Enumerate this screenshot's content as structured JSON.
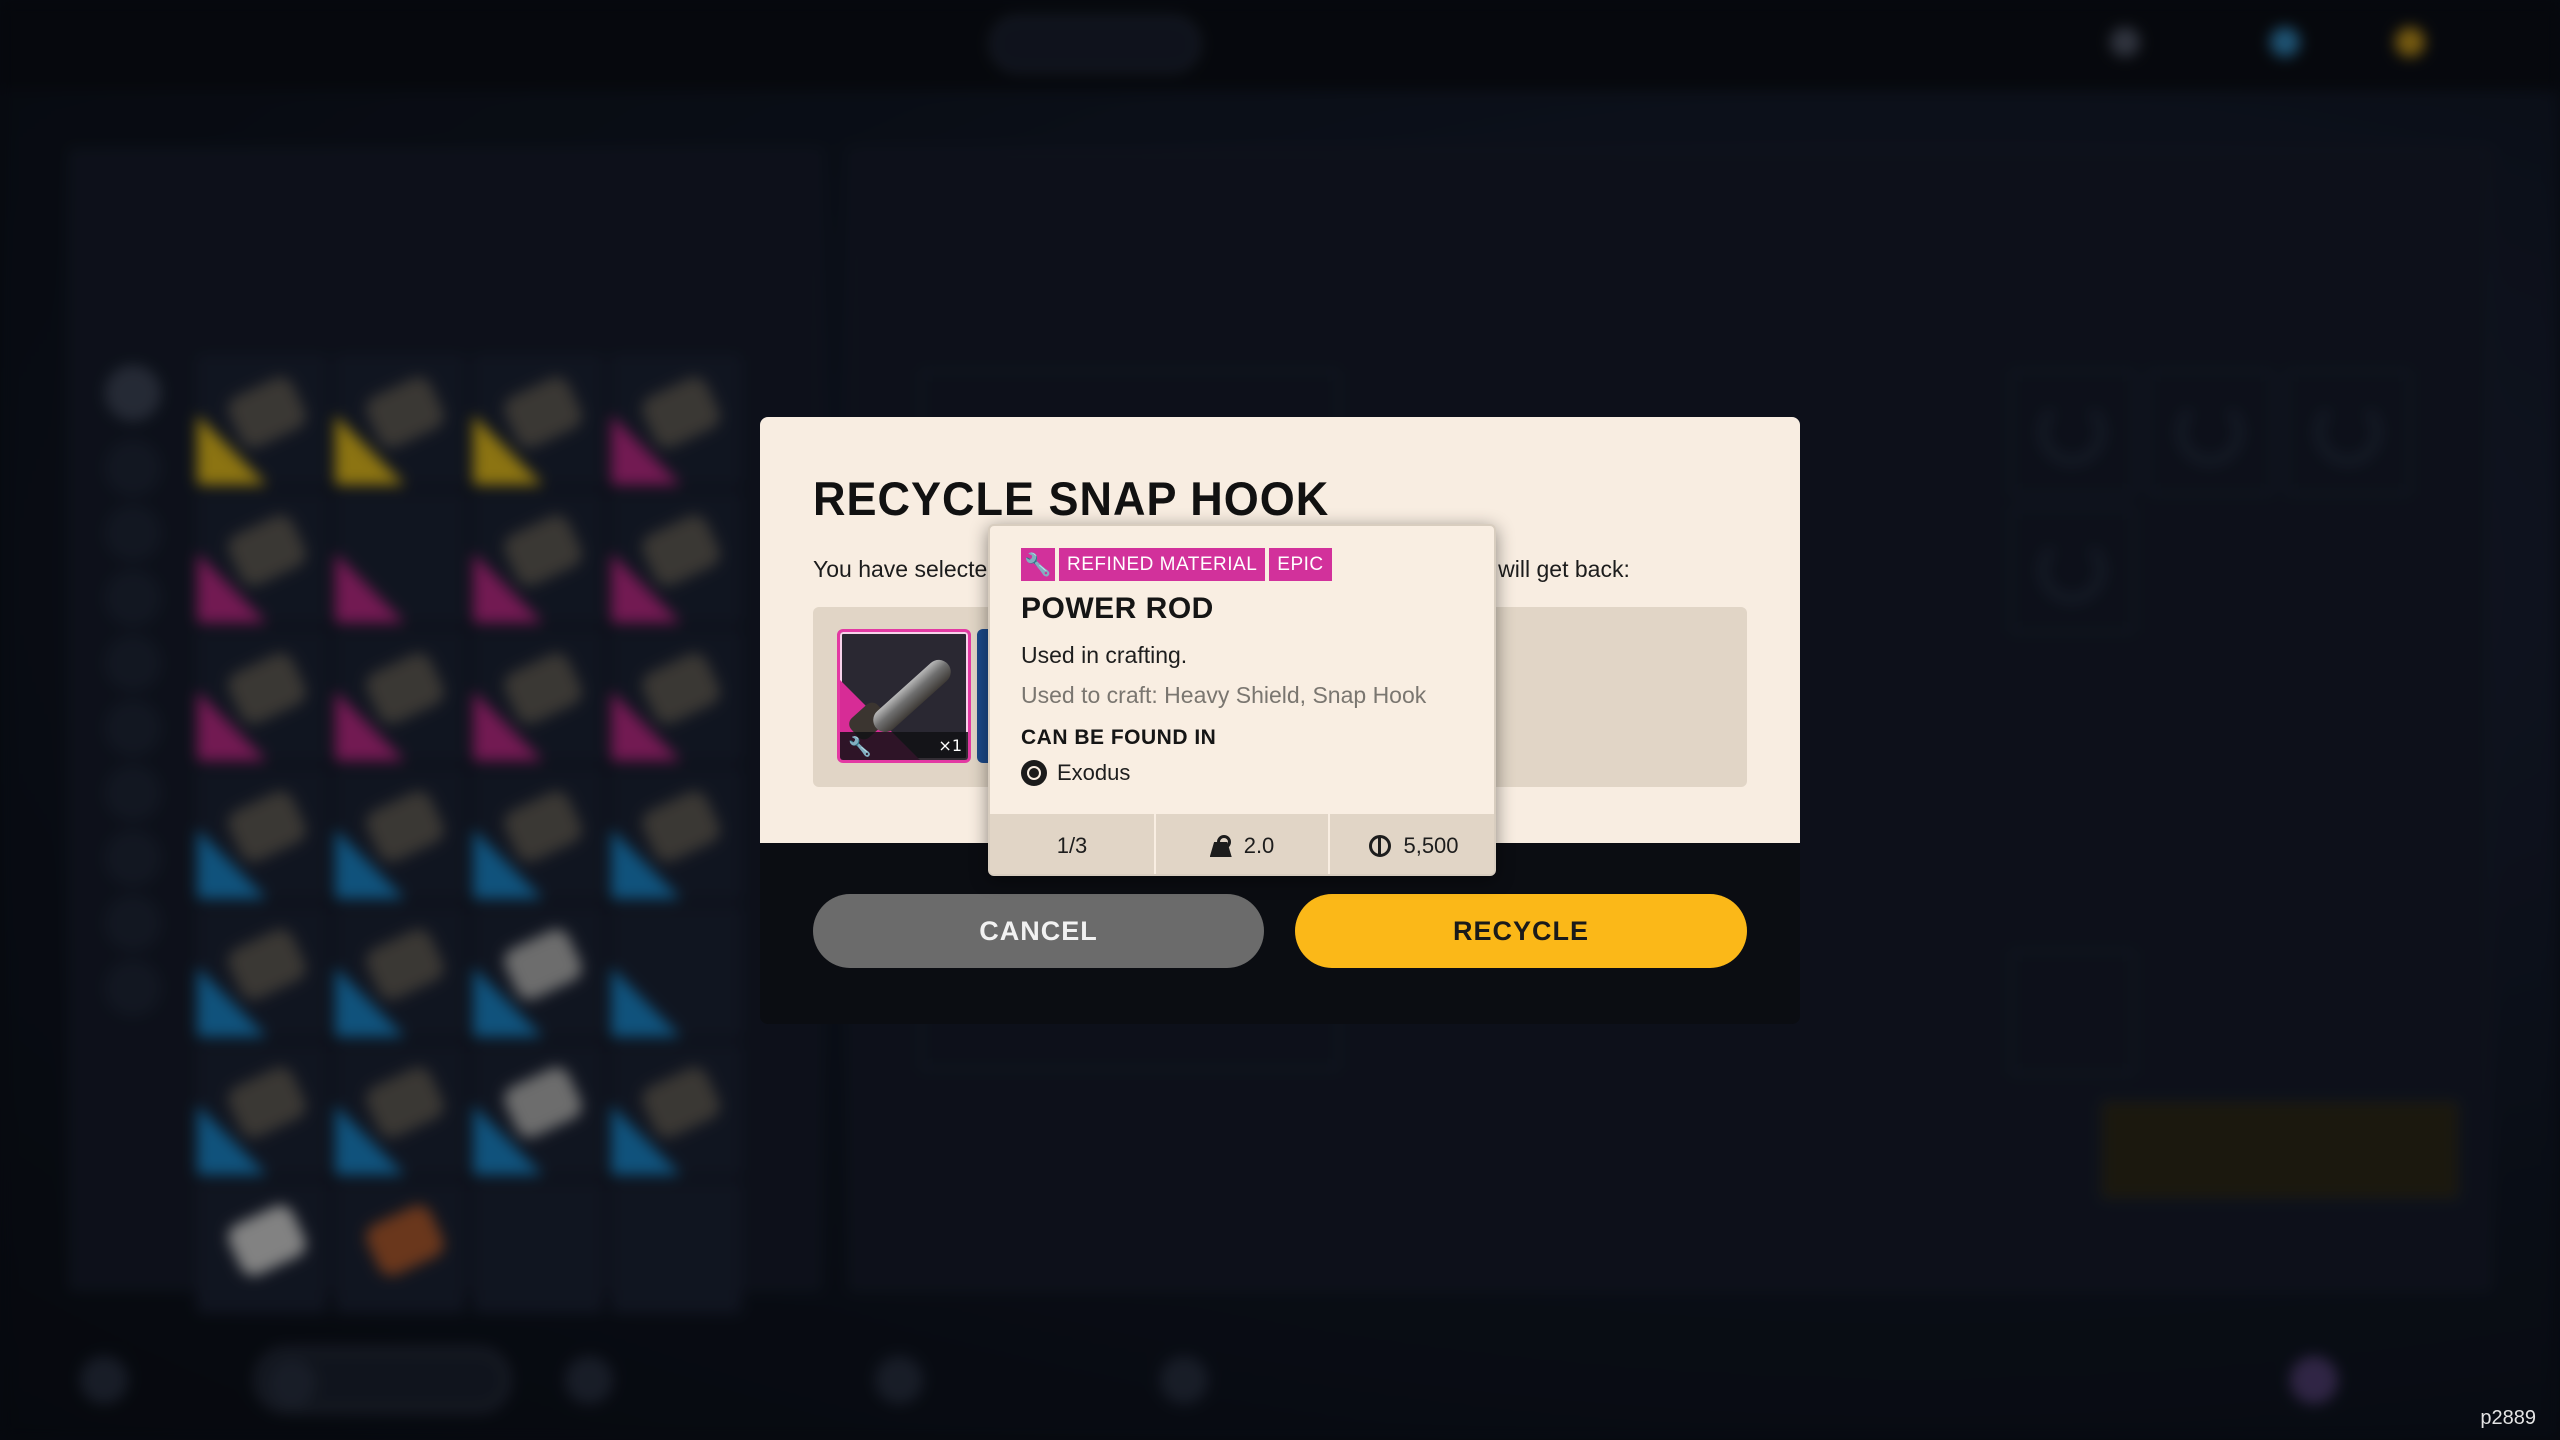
{
  "dialog": {
    "title": "RECYCLE SNAP HOOK",
    "message_left": "You have selecte",
    "message_right": "u will get back:",
    "cancel_label": "CANCEL",
    "recycle_label": "RECYCLE",
    "result_item": {
      "quantity": "×1",
      "icon": "power-rod"
    }
  },
  "tooltip": {
    "type_icon": "wrench-icon",
    "type_tag": "REFINED MATERIAL",
    "rarity_tag": "EPIC",
    "name": "POWER ROD",
    "description": "Used in crafting.",
    "used_to_craft": "Used to craft: Heavy Shield, Snap Hook",
    "found_heading": "CAN BE FOUND IN",
    "location": "Exodus",
    "stats": {
      "stack": "1/3",
      "weight": "2.0",
      "value": "5,500"
    }
  },
  "colors": {
    "epic": "#d2319b",
    "recycle_button": "#fbb818",
    "cancel_button": "#6b6b6b",
    "dialog_bg": "#f8ede1"
  },
  "build_id": "p2889"
}
